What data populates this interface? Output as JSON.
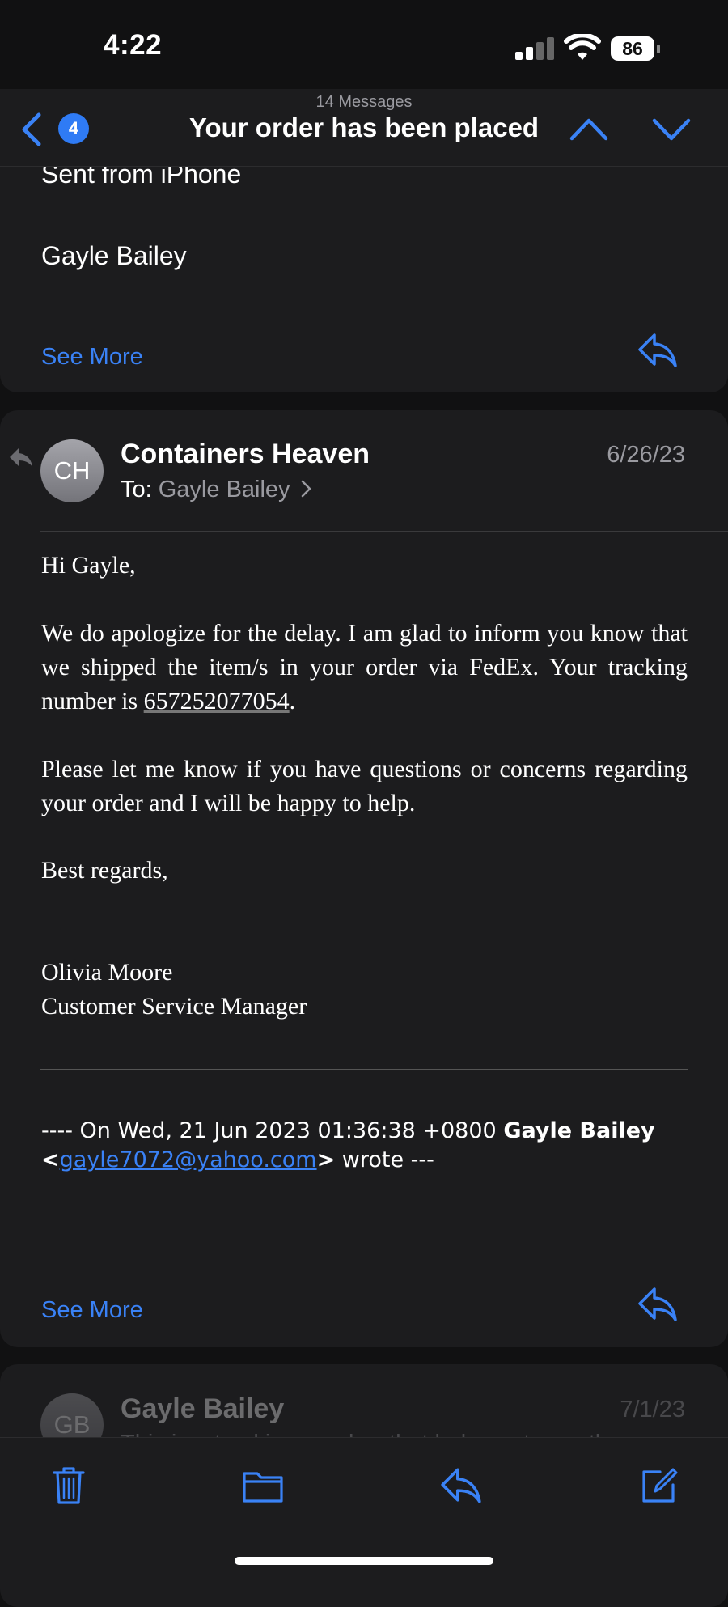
{
  "status": {
    "time": "4:22",
    "battery": "86"
  },
  "nav": {
    "back_badge": "4",
    "message_count": "14 Messages",
    "title": "Your order has been placed"
  },
  "message1": {
    "lines": [
      "Sent from iPhone",
      "Gayle Bailey"
    ],
    "see_more": "See More"
  },
  "message2": {
    "avatar_initials": "CH",
    "sender": "Containers Heaven",
    "to_label": "To:",
    "to_name": "Gayle Bailey",
    "date": "6/26/23",
    "greeting": "Hi Gayle,",
    "para1_before": "We do apologize for the delay. I am glad to inform you know that we shipped the item/s in your order via FedEx. Your tracking number is ",
    "tracking_number": "657252077054",
    "para1_after": ".",
    "para2": "Please let me know if you have questions or concerns regarding your order and I will be happy to help.",
    "closing": "Best regards,",
    "signature_name": "Olivia Moore",
    "signature_title": "Customer Service Manager",
    "quote_prefix": "---- On Wed, 21 Jun 2023 01:36:38 +0800 ",
    "quote_name": "Gayle Bailey",
    "quote_lt": "<",
    "quote_email": "gayle7072@yahoo.com",
    "quote_gt": ">",
    "quote_suffix": " wrote ---",
    "see_more": "See More"
  },
  "message3": {
    "avatar_initials": "GB",
    "sender": "Gayle Bailey",
    "date": "7/1/23",
    "preview": "This is a tracking number that belongs to another"
  },
  "colors": {
    "accent": "#3a82f6",
    "card": "#1c1c1e",
    "background": "#111112"
  },
  "icons": [
    "back-chevron-icon",
    "chevron-up-icon",
    "chevron-down-icon",
    "reply-icon",
    "trash-icon",
    "folder-icon",
    "compose-icon"
  ]
}
